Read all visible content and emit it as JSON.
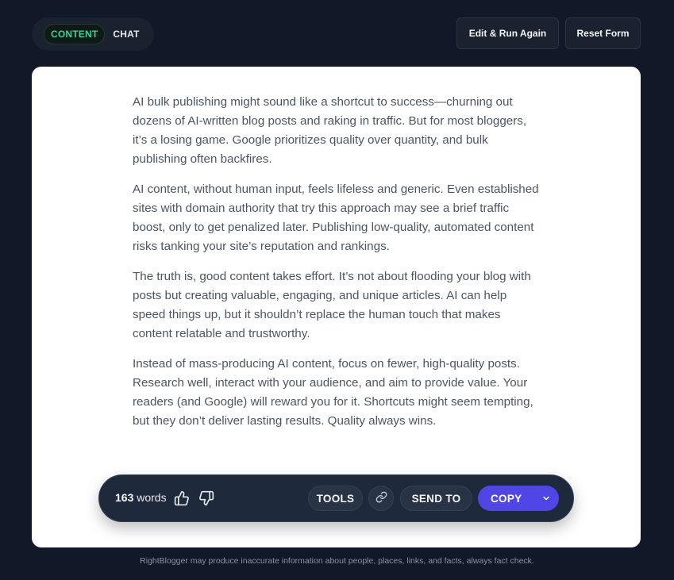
{
  "tabs": {
    "content_label": "CONTENT",
    "chat_label": "CHAT"
  },
  "header": {
    "edit_label": "Edit & Run Again",
    "reset_label": "Reset Form"
  },
  "article": {
    "paragraphs": [
      "AI bulk publishing might sound like a shortcut to success—churning out dozens of AI-written blog posts and raking in traffic. But for most bloggers, it’s a losing game. Google prioritizes quality over quantity, and bulk publishing often backfires.",
      "AI content, without human input, feels lifeless and generic. Even established sites with domain authority that try this approach may see a brief traffic boost, only to get penalized later. Publishing low-quality, automated content risks tanking your site’s reputation and rankings.",
      "The truth is, good content takes effort. It’s not about flooding your blog with posts but creating valuable, engaging, and unique articles. AI can help speed things up, but it shouldn’t replace the human touch that makes content relatable and trustworthy.",
      "Instead of mass-producing AI content, focus on fewer, high-quality posts. Research well, interact with your audience, and aim to provide value. Your readers (and Google) will reward you for it. Shortcuts might seem tempting, but they don’t deliver lasting results. Quality always wins."
    ]
  },
  "toolbar": {
    "word_count": "163",
    "word_unit": "words",
    "tools_label": "TOOLS",
    "send_to_label": "SEND TO",
    "copy_label": "COPY"
  },
  "icons": {
    "thumb_up": "thumbs-up-icon",
    "thumb_down": "thumbs-down-icon",
    "link": "link-icon",
    "caret": "chevron-down-icon"
  },
  "colors": {
    "background": "#111827",
    "accent_green": "#34d399",
    "copy_button": "#5046e5"
  },
  "footer": {
    "disclaimer": "RightBlogger may produce inaccurate information about people, places, links, and facts, always fact check."
  }
}
